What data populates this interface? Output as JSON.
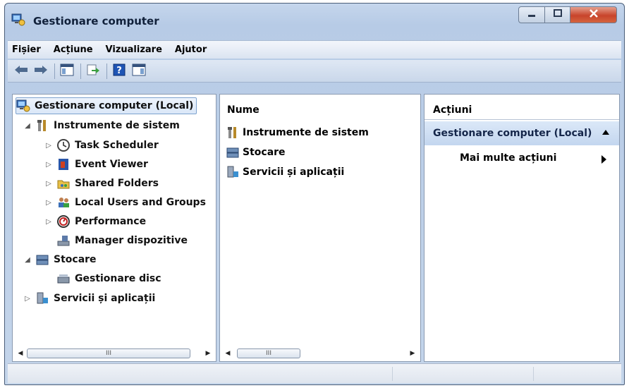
{
  "window": {
    "title": "Gestionare computer"
  },
  "menu": [
    "Fișier",
    "Acțiune",
    "Vizualizare",
    "Ajutor"
  ],
  "toolbar": {
    "buttons": [
      "back-arrow-icon",
      "forward-arrow-icon",
      "show-hide-console-tree-icon",
      "export-list-icon",
      "help-icon",
      "show-hide-action-pane-icon"
    ]
  },
  "tree": {
    "root": "Gestionare computer (Local)",
    "items": [
      {
        "label": "Instrumente de sistem",
        "expander": "◢"
      },
      {
        "label": "Task Scheduler",
        "expander": "▷"
      },
      {
        "label": "Event Viewer",
        "expander": "▷"
      },
      {
        "label": "Shared Folders",
        "expander": "▷"
      },
      {
        "label": "Local Users and Groups",
        "expander": "▷"
      },
      {
        "label": "Performance",
        "expander": "▷"
      },
      {
        "label": "Manager dispozitive",
        "expander": ""
      },
      {
        "label": "Stocare",
        "expander": "◢"
      },
      {
        "label": "Gestionare disc",
        "expander": ""
      },
      {
        "label": "Servicii și aplicații",
        "expander": "▷"
      }
    ]
  },
  "list": {
    "column_header": "Nume",
    "items": [
      "Instrumente de sistem",
      "Stocare",
      "Servicii și aplicații"
    ]
  },
  "actions": {
    "title": "Acțiuni",
    "group": "Gestionare computer (Local)",
    "item": "Mai multe acțiuni"
  },
  "scrollbar": {
    "thumb_grip": "III",
    "left_arrow": "◀",
    "right_arrow": "▶"
  },
  "colors": {
    "title_text": "#10203a",
    "selection_bg": "#dae7f8",
    "close_button": "#c8442b"
  }
}
